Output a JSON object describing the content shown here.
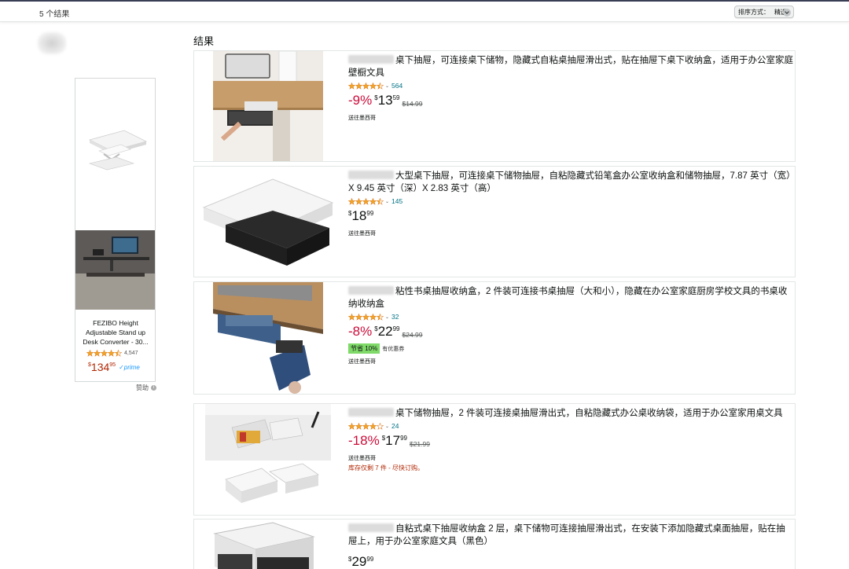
{
  "header": {
    "result_count": "5 个结果",
    "sort": {
      "label": "排序方式：",
      "value": "精选"
    }
  },
  "section_title": "结果",
  "sponsored_ad": {
    "title": "FEZIBO Height Adjustable Stand up Desk Converter - 30...",
    "rating_stars": 4.5,
    "review_count": "4,547",
    "price": {
      "symbol": "$",
      "whole": "134",
      "fraction": "95"
    },
    "prime": "✓prime",
    "sponsored_label": "赞助",
    "info_icon": "i"
  },
  "products": [
    {
      "title": "桌下抽屉，可连接桌下储物，隐藏式自粘桌抽屉滑出式，贴在抽屉下桌下收纳盒，适用于办公室家庭壁橱文具",
      "rating_stars": 4.5,
      "review_count": "564",
      "discount": "-9%",
      "price": {
        "symbol": "$",
        "whole": "13",
        "fraction": "59"
      },
      "list_price": "$14.99",
      "coupon": null,
      "coupon_note": null,
      "shipping": "送往墨西哥",
      "stock": null
    },
    {
      "title": "大型桌下抽屉，可连接桌下储物抽屉，自粘隐藏式铅笔盒办公室收纳盒和储物抽屉，7.87 英寸（宽）X 9.45 英寸（深）X 2.83 英寸（高）",
      "rating_stars": 4.5,
      "review_count": "145",
      "discount": null,
      "price": {
        "symbol": "$",
        "whole": "18",
        "fraction": "99"
      },
      "list_price": null,
      "coupon": null,
      "coupon_note": null,
      "shipping": "送往墨西哥",
      "stock": null
    },
    {
      "title": "粘性书桌抽屉收纳盒，2 件装可连接书桌抽屉（大和小），隐藏在办公室家庭厨房学校文具的书桌收纳收纳盒",
      "rating_stars": 4.5,
      "review_count": "32",
      "discount": "-8%",
      "price": {
        "symbol": "$",
        "whole": "22",
        "fraction": "99"
      },
      "list_price": "$24.99",
      "coupon": "节省 10%",
      "coupon_note": "有优惠券",
      "shipping": "送往墨西哥",
      "stock": null
    },
    {
      "title": "桌下储物抽屉，2 件装可连接桌抽屉滑出式，自粘隐藏式办公桌收纳袋，适用于办公室家用桌文具",
      "rating_stars": 4,
      "review_count": "24",
      "discount": "-18%",
      "price": {
        "symbol": "$",
        "whole": "17",
        "fraction": "99"
      },
      "list_price": "$21.99",
      "coupon": null,
      "coupon_note": null,
      "shipping": "送往墨西哥",
      "stock": "库存仅剩 7 件 - 尽快订购。"
    },
    {
      "title": "自粘式桌下抽屉收纳盒 2 层，桌下储物可连接抽屉滑出式，在安装下添加隐藏式桌面抽屉，贴在抽屉上，用于办公室家庭文具（黑色）",
      "rating_stars": null,
      "review_count": null,
      "discount": null,
      "price": {
        "symbol": "$",
        "whole": "29",
        "fraction": "99"
      },
      "list_price": null,
      "coupon": null,
      "coupon_note": null,
      "shipping": null,
      "stock": null
    }
  ],
  "colors": {
    "discount_red": "#cc0c39",
    "stock_red": "#b12704",
    "star_orange": "#f0a623",
    "review_link": "#007185",
    "coupon_green": "#7fda69",
    "prime_blue": "#1a98ff"
  },
  "icons": [
    "sort-chevron-icon",
    "star-icon",
    "rating-caret-icon",
    "info-icon"
  ]
}
